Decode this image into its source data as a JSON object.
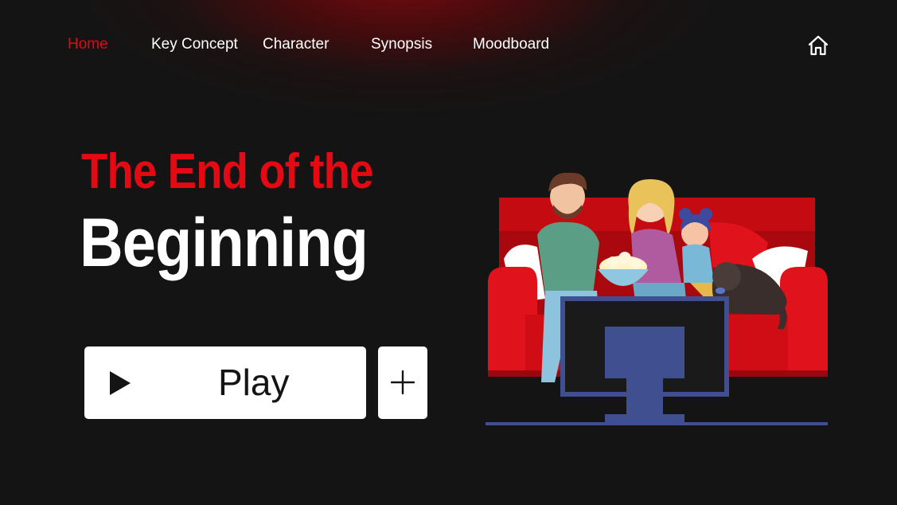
{
  "nav": {
    "items": [
      {
        "label": "Home",
        "active": true
      },
      {
        "label": "Key Concept",
        "active": false
      },
      {
        "label": "Character",
        "active": false
      },
      {
        "label": "Synopsis",
        "active": false
      },
      {
        "label": "Moodboard",
        "active": false
      }
    ],
    "home_icon": "home-icon"
  },
  "hero": {
    "title_line1": "The End of the",
    "title_line2": "Beginning"
  },
  "actions": {
    "play_label": "Play",
    "play_icon": "play-icon",
    "add_icon": "plus-icon"
  },
  "colors": {
    "accent": "#e50914",
    "background": "#141414",
    "text": "#ffffff",
    "tv": "#3f4f8f"
  }
}
